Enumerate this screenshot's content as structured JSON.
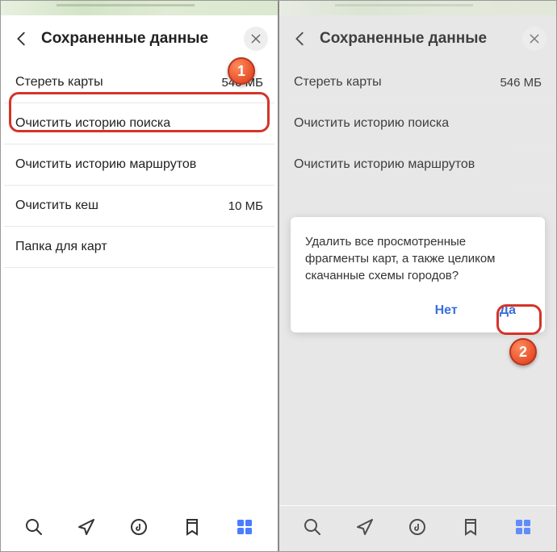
{
  "left": {
    "header": {
      "title": "Сохраненные данные"
    },
    "items": [
      {
        "label": "Стереть карты",
        "value": "546 МБ"
      },
      {
        "label": "Очистить историю поиска",
        "value": ""
      },
      {
        "label": "Очистить историю маршрутов",
        "value": ""
      },
      {
        "label": "Очистить кеш",
        "value": "10 МБ"
      },
      {
        "label": "Папка для карт",
        "value": ""
      }
    ]
  },
  "right": {
    "header": {
      "title": "Сохраненные данные"
    },
    "items": [
      {
        "label": "Стереть карты",
        "value": "546 МБ"
      },
      {
        "label": "Очистить историю поиска",
        "value": ""
      },
      {
        "label": "Очистить историю маршрутов",
        "value": ""
      }
    ],
    "dialog": {
      "message": "Удалить все просмотренные фрагменты карт, а также целиком скачанные схемы городов?",
      "no": "Нет",
      "yes": "Да"
    }
  },
  "badges": {
    "one": "1",
    "two": "2"
  }
}
